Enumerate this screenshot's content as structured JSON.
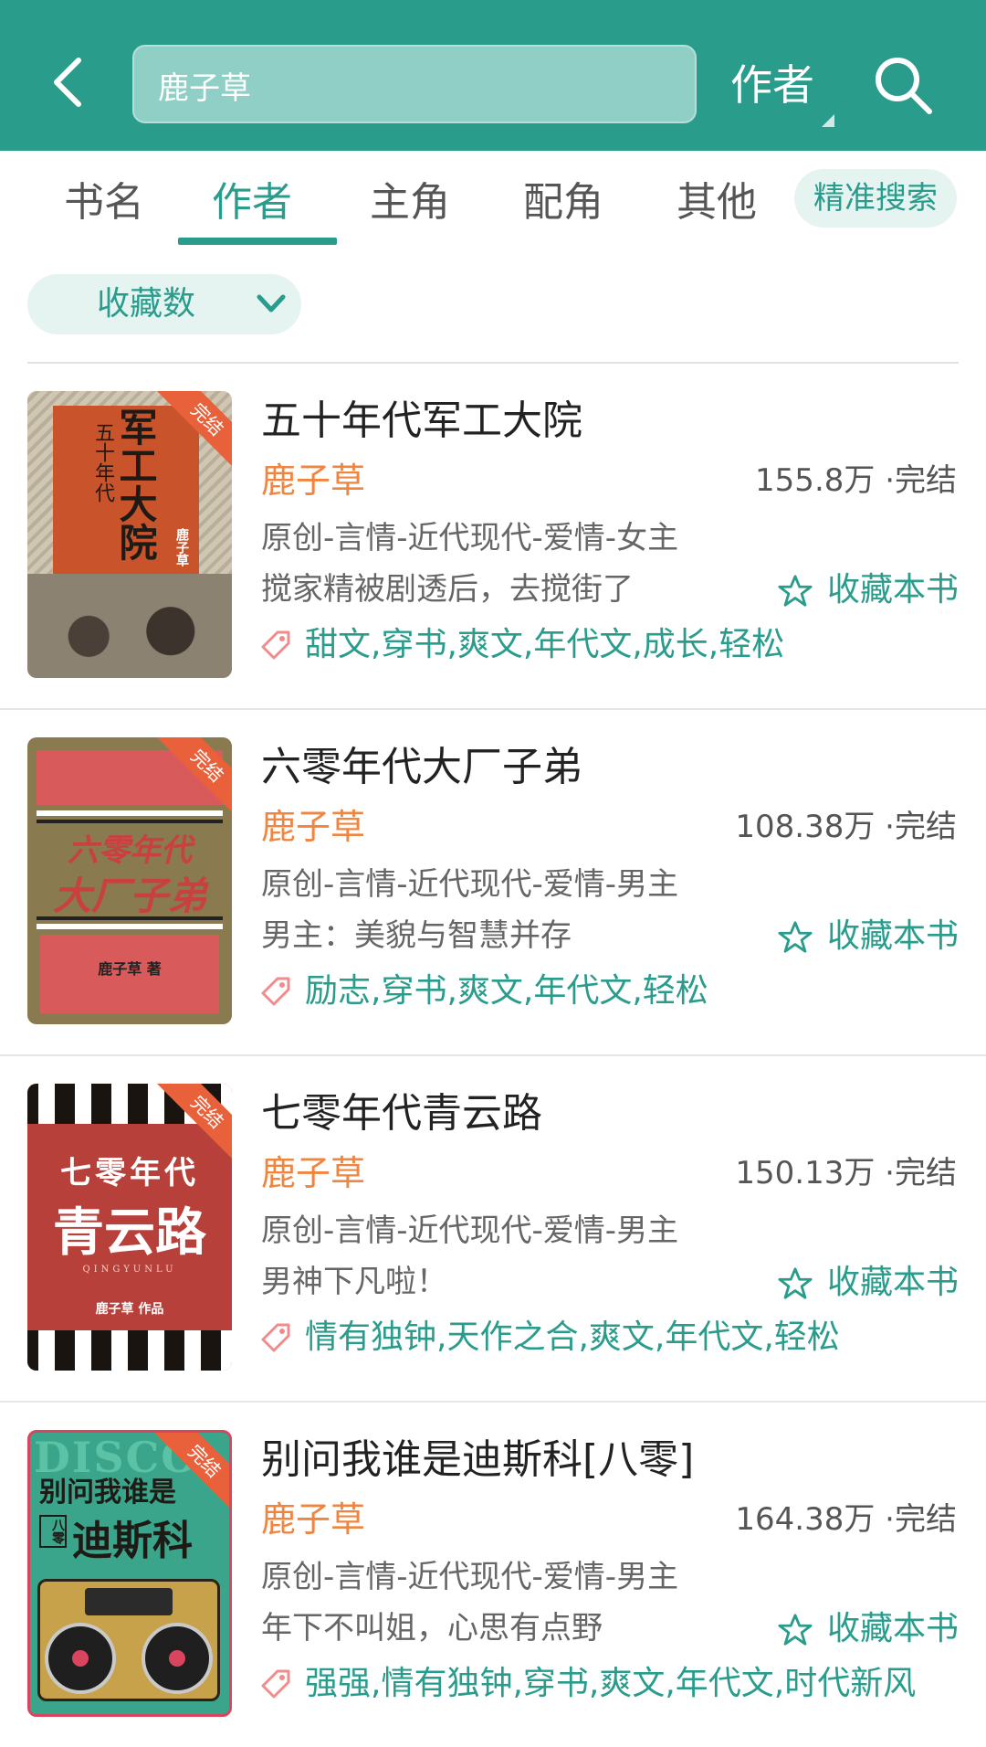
{
  "header": {
    "search_value": "鹿子草",
    "search_type": "作者"
  },
  "tabs": [
    {
      "label": "书名",
      "active": false
    },
    {
      "label": "作者",
      "active": true
    },
    {
      "label": "主角",
      "active": false
    },
    {
      "label": "配角",
      "active": false
    },
    {
      "label": "其他",
      "active": false
    }
  ],
  "precise_search_label": "精准搜索",
  "sort": {
    "label": "收藏数"
  },
  "collect_label": "收藏本书",
  "books": [
    {
      "title": "五十年代军工大院",
      "author": "鹿子草",
      "stats": "155.8万 ·完结",
      "category": "原创-言情-近代现代-爱情-女主",
      "description": "搅家精被剧透后，去搅街了",
      "tags": "甜文,穿书,爽文,年代文,成长,轻松",
      "badge": "完结",
      "cover_text": {
        "main": "军工大院",
        "sub": "五十年代",
        "author": "鹿子草"
      }
    },
    {
      "title": "六零年代大厂子弟",
      "author": "鹿子草",
      "stats": "108.38万 ·完结",
      "category": "原创-言情-近代现代-爱情-男主",
      "description": "男主：美貌与智慧并存",
      "tags": "励志,穿书,爽文,年代文,轻松",
      "badge": "完结",
      "cover_text": {
        "line1": "六零年代",
        "line2": "大厂子弟",
        "author": "鹿子草 著"
      }
    },
    {
      "title": "七零年代青云路",
      "author": "鹿子草",
      "stats": "150.13万 ·完结",
      "category": "原创-言情-近代现代-爱情-男主",
      "description": "男神下凡啦！",
      "tags": "情有独钟,天作之合,爽文,年代文,轻松",
      "badge": "完结",
      "cover_text": {
        "line1": "七零年代",
        "line2": "青云路",
        "pinyin": "QINGYUNLU",
        "author": "鹿子草  作品"
      }
    },
    {
      "title": "别问我谁是迪斯科[八零]",
      "author": "鹿子草",
      "stats": "164.38万 ·完结",
      "category": "原创-言情-近代现代-爱情-男主",
      "description": "年下不叫姐，心思有点野",
      "tags": "强强,情有独钟,穿书,爽文,年代文,时代新风",
      "badge": "完结",
      "cover_text": {
        "line1": "别问我谁是",
        "line2": "迪斯科",
        "side": "八零",
        "bg": "DISCO"
      }
    }
  ],
  "colors": {
    "primary": "#2a9c8c",
    "author": "#f08540",
    "badge": "#e8613a"
  }
}
